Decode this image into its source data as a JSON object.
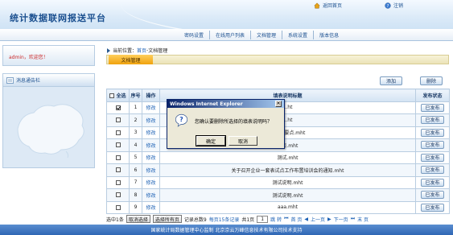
{
  "header": {
    "title": "统计数据联网报送平台",
    "home_label": "返回首页",
    "logout_label": "注销"
  },
  "nav": {
    "items": [
      "密码设置",
      "在线用户列表",
      "文档管理",
      "系统设置",
      "版本信息"
    ]
  },
  "sidebar": {
    "welcome": "admin，欢迎您！",
    "notice_title": "消息通告栏"
  },
  "breadcrumb": {
    "prefix": "当前位置：",
    "home": "首页",
    "separator": "-",
    "current": "文档管理"
  },
  "tab": {
    "label": "文档管理"
  },
  "actions": {
    "add": "添加",
    "delete": "删除"
  },
  "table": {
    "headers": [
      "全选",
      "序号",
      "操作",
      "填表说明标题",
      "发布状态"
    ],
    "rows": [
      {
        "checked": true,
        "index": "1",
        "action": "修改",
        "title": "...ht",
        "status": "已发布"
      },
      {
        "checked": false,
        "index": "2",
        "action": "修改",
        "title": "...ht",
        "status": "已发布"
      },
      {
        "checked": false,
        "index": "3",
        "action": "修改",
        "title": "...时的要点.mht",
        "status": "已发布"
      },
      {
        "checked": false,
        "index": "4",
        "action": "修改",
        "title": "...点.mht",
        "status": "已发布"
      },
      {
        "checked": false,
        "index": "5",
        "action": "修改",
        "title": "测试.mht",
        "status": "已发布"
      },
      {
        "checked": false,
        "index": "6",
        "action": "修改",
        "title": "关于召开企业一套表试点工作布置培训会的通知.mht",
        "status": "已发布"
      },
      {
        "checked": false,
        "index": "7",
        "action": "修改",
        "title": "测试说明.mht",
        "status": "已发布"
      },
      {
        "checked": false,
        "index": "8",
        "action": "修改",
        "title": "测试说明.mht",
        "status": "已发布"
      },
      {
        "checked": false,
        "index": "9",
        "action": "修改",
        "title": "aaa.mht",
        "status": "已发布"
      }
    ]
  },
  "pager": {
    "selected_label": "选中1条",
    "cancel_select": "取消选择",
    "select_all": "选择所有页",
    "summary_prefix": "记录总数9",
    "per_page": "每页15条记录",
    "page_count": "共1页",
    "page_input": "1",
    "go": "跳 转",
    "first": "首 页",
    "prev": "上一页",
    "next": "下一页",
    "last": "末 页"
  },
  "footer": {
    "text": "国家统计局数据管理中心监制  北京京云万峰信息技术有限公司技术支持"
  },
  "dialog": {
    "title": "Windows Internet Explorer",
    "message": "您确认要删除所选择的填表说明吗？",
    "ok": "确定",
    "cancel": "取消"
  },
  "colors": {
    "brand_blue": "#1a4f8f",
    "footer_blue": "#2f66b4",
    "tab_orange": "#f0a20d",
    "link_blue": "#1a5fb4"
  }
}
